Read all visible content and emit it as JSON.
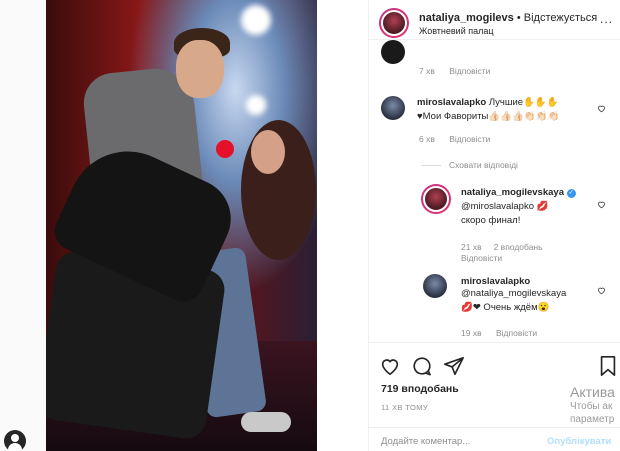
{
  "header": {
    "username": "nataliya_mogilevs",
    "separator": "•",
    "follow_status": "Відстежується",
    "location": "Жовтневий палац",
    "more": "..."
  },
  "comments": [
    {
      "username": "",
      "text": "",
      "time": "7 хв",
      "reply": "Відповісти"
    },
    {
      "username": "miroslavalapko",
      "text": "Лучшие✋✋✋",
      "text2": "♥Мои Фавориты👍🏻👍🏻👍🏻👏🏻👏🏻👏🏻",
      "time": "6 хв",
      "reply": "Відповісти"
    }
  ],
  "hide_replies": "Сховати відповіді",
  "replies": [
    {
      "username": "nataliya_mogilevskaya",
      "verified": "✓",
      "text": "@miroslavalapko 💋",
      "text2": "скоро финал!",
      "time": "21 хв",
      "likes": "2 вподобань",
      "reply": "Відповісти"
    },
    {
      "username": "miroslavalapko",
      "text": "@nataliya_mogilevskaya",
      "text2": "💋❤ Очень ждём😮",
      "time": "19 хв",
      "reply": "Відповісти"
    }
  ],
  "post": {
    "likes": "719 вподобань",
    "time_ago": "11 ХВ ТОМУ",
    "add_comment_placeholder": "Додайте коментар...",
    "publish": "Опублікувати"
  },
  "watermark": {
    "line1": "Актива",
    "line2": "Чтобы ак",
    "line3": "параметр"
  },
  "icons": [
    "heart-icon",
    "comment-icon",
    "share-icon",
    "bookmark-icon",
    "profile-icon"
  ],
  "colors": {
    "link": "#3897f0",
    "publish_disabled": "#b2dffc",
    "meta": "#8e8e8e",
    "mic": "#e5102a"
  }
}
